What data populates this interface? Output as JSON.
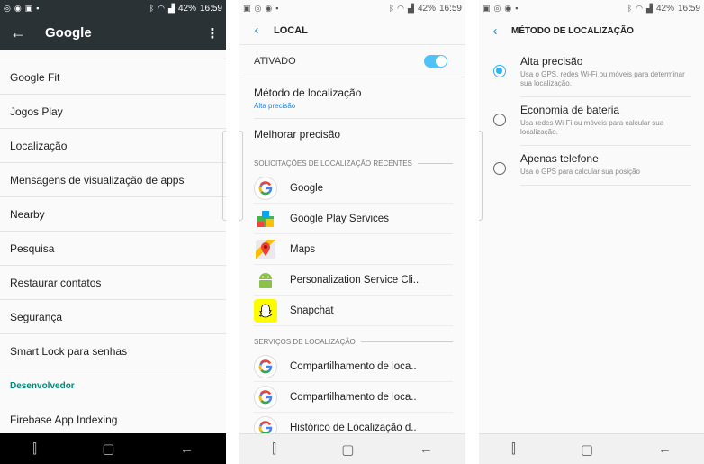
{
  "status": {
    "battery": "42%",
    "time": "16:59"
  },
  "panel1": {
    "title": "Google",
    "items": [
      "Google Fit",
      "Jogos Play",
      "Localização",
      "Mensagens de visualização de apps",
      "Nearby",
      "Pesquisa",
      "Restaurar contatos",
      "Segurança",
      "Smart Lock para senhas"
    ],
    "section": "Desenvolvedor",
    "after_items": [
      "Firebase App Indexing"
    ]
  },
  "panel2": {
    "title": "LOCAL",
    "toggle_label": "ATIVADO",
    "toggle_on": true,
    "method_title": "Método de localização",
    "method_value": "Alta precisão",
    "improve": "Melhorar precisão",
    "recent_header": "SOLICITAÇÕES DE LOCALIZAÇÃO RECENTES",
    "recent": [
      {
        "label": "Google",
        "icon": "google-icon"
      },
      {
        "label": "Google Play Services",
        "icon": "play-services-icon"
      },
      {
        "label": "Maps",
        "icon": "maps-icon"
      },
      {
        "label": "Personalization Service Cli..",
        "icon": "android-icon"
      },
      {
        "label": "Snapchat",
        "icon": "snapchat-icon"
      }
    ],
    "services_header": "SERVIÇOS DE LOCALIZAÇÃO",
    "services": [
      {
        "label": "Compartilhamento de loca..",
        "icon": "google-icon"
      },
      {
        "label": "Compartilhamento de loca..",
        "icon": "google-icon"
      },
      {
        "label": "Histórico de Localização d..",
        "icon": "google-icon"
      }
    ]
  },
  "panel3": {
    "title": "MÉTODO DE LOCALIZAÇÃO",
    "options": [
      {
        "title": "Alta precisão",
        "desc": "Usa o GPS, redes Wi-Fi ou móveis para determinar sua localização.",
        "selected": true
      },
      {
        "title": "Economia de bateria",
        "desc": "Usa redes Wi-Fi ou móveis para calcular sua localização.",
        "selected": false
      },
      {
        "title": "Apenas telefone",
        "desc": "Usa o GPS para calcular sua posição",
        "selected": false
      }
    ]
  },
  "colors": {
    "accent": "#1e88e5",
    "teal": "#00897b",
    "toolbar": "#2b3236"
  }
}
